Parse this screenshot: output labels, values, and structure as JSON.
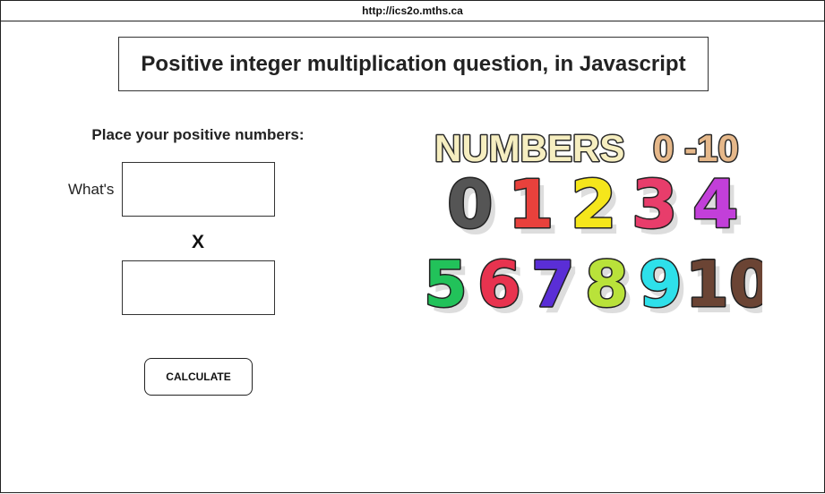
{
  "browser": {
    "url": "http://ics2o.mths.ca"
  },
  "page": {
    "title": "Positive integer multiplication question, in Javascript",
    "prompt": "Place your positive numbers:",
    "whats_label": "What's",
    "times_symbol": "X",
    "first_input": {
      "value": "",
      "placeholder": ""
    },
    "second_input": {
      "value": "",
      "placeholder": ""
    },
    "calculate_label": "CALCULATE"
  },
  "illustration": {
    "heading_word": "NUMBERS",
    "heading_range": "0 -10",
    "row1": [
      {
        "d": "0",
        "color": "#555555"
      },
      {
        "d": "1",
        "color": "#e8413c"
      },
      {
        "d": "2",
        "color": "#f5e61b"
      },
      {
        "d": "3",
        "color": "#e83d6b"
      },
      {
        "d": "4",
        "color": "#c23fd9"
      }
    ],
    "row2": [
      {
        "d": "5",
        "color": "#22c25a"
      },
      {
        "d": "6",
        "color": "#e8334f"
      },
      {
        "d": "7",
        "color": "#5a2ed6"
      },
      {
        "d": "8",
        "color": "#b9e23a"
      },
      {
        "d": "9",
        "color": "#2ee0ea"
      },
      {
        "d": "10",
        "color": "#6b4434"
      }
    ],
    "heading_colors": {
      "word": "#f6eec0",
      "range": "#e6b88a"
    }
  }
}
